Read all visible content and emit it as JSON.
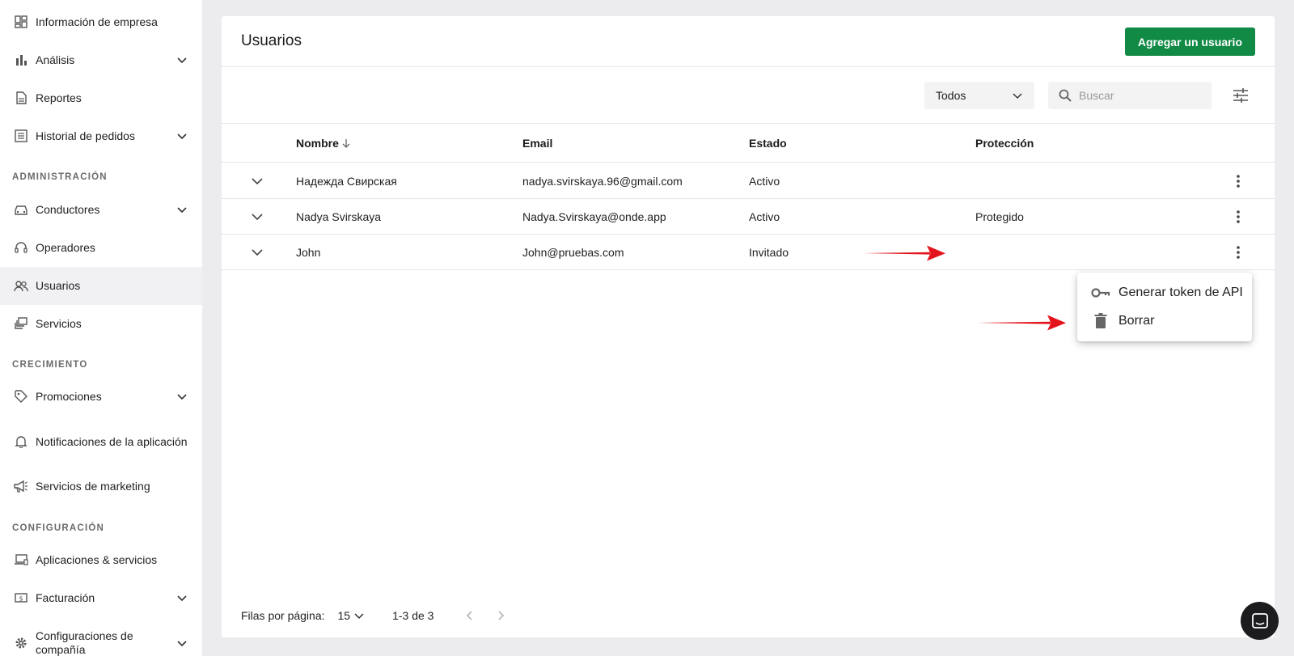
{
  "sidebar": {
    "items": [
      {
        "label": "Información de empresa",
        "icon": "dashboard-icon",
        "expandable": false
      },
      {
        "label": "Análisis",
        "icon": "bar-chart-icon",
        "expandable": true
      },
      {
        "label": "Reportes",
        "icon": "document-icon",
        "expandable": false
      },
      {
        "label": "Historial de pedidos",
        "icon": "list-icon",
        "expandable": true
      },
      {
        "label": "Conductores",
        "icon": "car-icon",
        "expandable": true
      },
      {
        "label": "Operadores",
        "icon": "headset-icon",
        "expandable": false
      },
      {
        "label": "Usuarios",
        "icon": "users-icon",
        "expandable": false,
        "active": true
      },
      {
        "label": "Servicios",
        "icon": "layers-icon",
        "expandable": false
      },
      {
        "label": "Promociones",
        "icon": "tag-icon",
        "expandable": true
      },
      {
        "label": "Notificaciones de la aplicación",
        "icon": "bell-icon",
        "expandable": false
      },
      {
        "label": "Servicios de marketing",
        "icon": "megaphone-icon",
        "expandable": false
      },
      {
        "label": "Aplicaciones & servicios",
        "icon": "devices-icon",
        "expandable": false
      },
      {
        "label": "Facturación",
        "icon": "billing-icon",
        "expandable": true
      },
      {
        "label": "Configuraciones de compañía",
        "icon": "gear-icon",
        "expandable": true
      }
    ],
    "sections": {
      "admin": "ADMINISTRACIÓN",
      "growth": "CRECIMIENTO",
      "config": "CONFIGURACIÓN"
    }
  },
  "header": {
    "title": "Usuarios",
    "add_button": "Agregar un usuario"
  },
  "toolbar": {
    "filter_value": "Todos",
    "search_placeholder": "Buscar"
  },
  "table": {
    "columns": [
      "Nombre",
      "Email",
      "Estado",
      "Protección"
    ],
    "sort_column": "Nombre",
    "rows": [
      {
        "name": "Надежда Свирская",
        "email": "nadya.svirskaya.96@gmail.com",
        "status": "Activo",
        "protection": ""
      },
      {
        "name": "Nadya Svirskaya",
        "email": "Nadya.Svirskaya@onde.app",
        "status": "Activo",
        "protection": "Protegido"
      },
      {
        "name": "John",
        "email": "John@pruebas.com",
        "status": "Invitado",
        "protection": ""
      }
    ]
  },
  "row_menu": {
    "items": [
      {
        "label": "Generar token de API",
        "icon": "key-icon"
      },
      {
        "label": "Borrar",
        "icon": "trash-icon"
      }
    ]
  },
  "pagination": {
    "rows_per_page_label": "Filas por página:",
    "rows_per_page": "15",
    "range": "1-3 de 3"
  },
  "colors": {
    "primary_green": "#108a45",
    "annotation_arrow": "#e3141b",
    "active_nav_bg": "#f1f1f3"
  }
}
